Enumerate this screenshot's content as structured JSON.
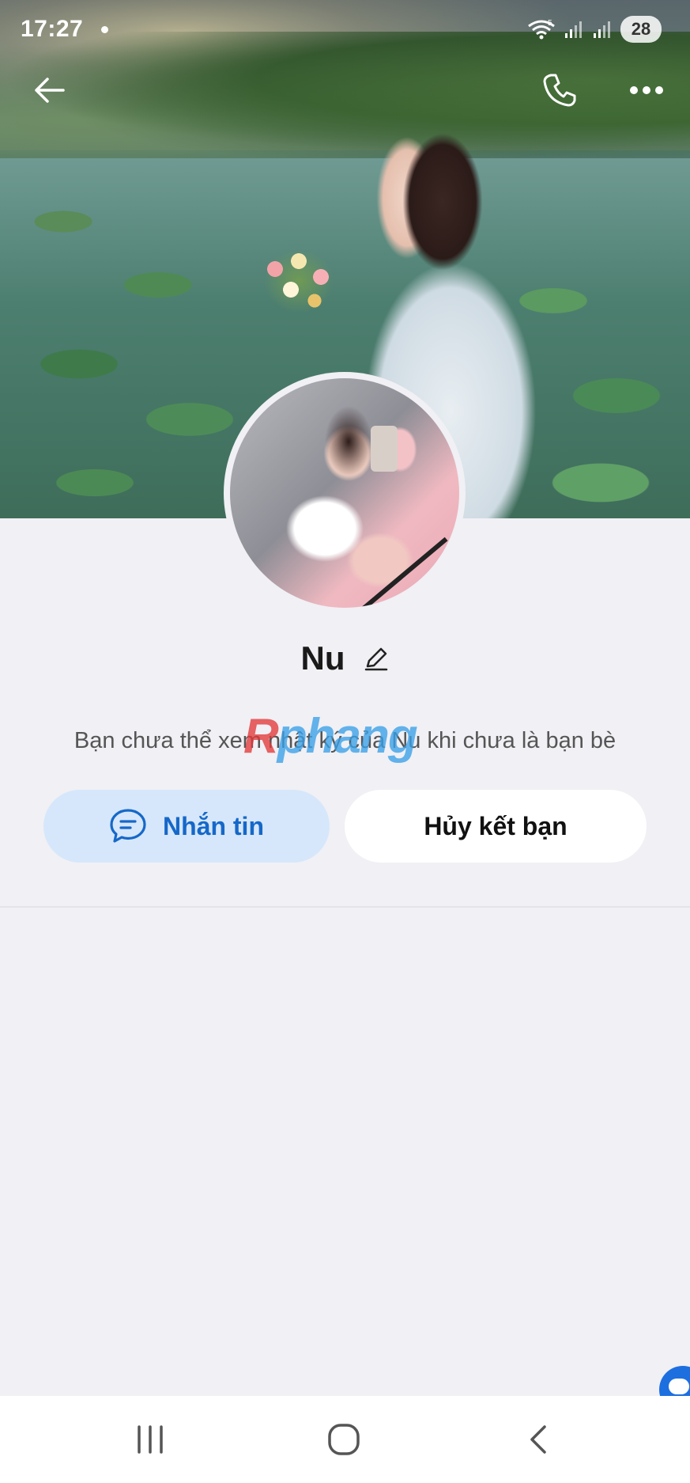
{
  "status_bar": {
    "time": "17:27",
    "battery": "28",
    "network_label": "5"
  },
  "header": {
    "back_icon": "arrow-left-icon",
    "call_icon": "phone-icon",
    "more_icon": "more-horizontal-icon"
  },
  "profile": {
    "name": "Nu",
    "edit_icon": "pencil-icon",
    "diary_notice": "Bạn chưa thể xem nhật ký của Nu khi chưa là bạn bè",
    "watermark_part1": "R",
    "watermark_part2": "phang"
  },
  "actions": {
    "message_label": "Nhắn tin",
    "message_icon": "chat-bubble-icon",
    "unfriend_label": "Hủy kết bạn"
  },
  "colors": {
    "accent": "#1668c8",
    "message_button_bg": "#d6e7fb",
    "page_bg": "#f0f0f5"
  },
  "nav": {
    "recents_icon": "recent-apps-icon",
    "home_icon": "home-icon",
    "back_icon": "back-chevron-icon"
  }
}
